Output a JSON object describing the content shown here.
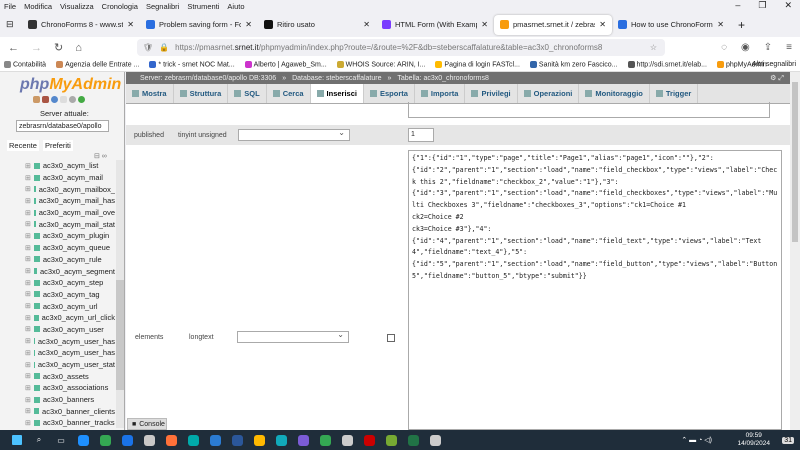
{
  "menubar": [
    "File",
    "Modifica",
    "Visualizza",
    "Cronologia",
    "Segnalibri",
    "Strumenti",
    "Aiuto"
  ],
  "browser_tabs": [
    {
      "title": "ChronoForms 8 - www.stebersca",
      "color": "#333"
    },
    {
      "title": "Problem saving form - Forums",
      "color": "#2a6ee0"
    },
    {
      "title": "Ritiro usato",
      "color": "#111"
    },
    {
      "title": "HTML Form (With Examples)",
      "color": "#7a3cff"
    },
    {
      "title": "pmasrnet.srnet.it / zebrasrn/da",
      "color": "#f89c0e",
      "active": true
    },
    {
      "title": "How to use ChronoForms 8 - In",
      "color": "#2a6ee0"
    }
  ],
  "url": {
    "prefix": "https://pmasrnet.",
    "domain": "srnet.it",
    "rest": "/phpmyadmin/index.php?route=/&route=%2F&db=steberscaffalature&table=ac3x0_chronoforms8"
  },
  "bookmarks": [
    "Contabilità",
    "Agenzia delle Entrate ...",
    "* trick - srnet NOC Mat...",
    "Alberto | Agaweb_Sm...",
    "WHOIS Source: ARIN, I...",
    "Pagina di login FASTcl...",
    "Sanità km zero Fascico...",
    "http://sdi.srnet.it/elab...",
    "phpMyAdmin"
  ],
  "bookmarks_other": "Altri segnalibri",
  "sidebar": {
    "logo_php": "php",
    "logo_myadmin": "MyAdmin",
    "server_label": "Server attuale:",
    "server_value": "zebrasrn/database0/apollo",
    "recent": "Recente",
    "favorites": "Preferiti",
    "tables": [
      "ac3x0_acym_list",
      "ac3x0_acym_mail",
      "ac3x0_acym_mailbox_",
      "ac3x0_acym_mail_has",
      "ac3x0_acym_mail_ove",
      "ac3x0_acym_mail_stat",
      "ac3x0_acym_plugin",
      "ac3x0_acym_queue",
      "ac3x0_acym_rule",
      "ac3x0_acym_segment",
      "ac3x0_acym_step",
      "ac3x0_acym_tag",
      "ac3x0_acym_url",
      "ac3x0_acym_url_click",
      "ac3x0_acym_user",
      "ac3x0_acym_user_has",
      "ac3x0_acym_user_has",
      "ac3x0_acym_user_stat",
      "ac3x0_assets",
      "ac3x0_associations",
      "ac3x0_banners",
      "ac3x0_banner_clients",
      "ac3x0_banner_tracks"
    ]
  },
  "breadcrumb": [
    "Server: zebrasrn/database0/apollo DB:3306",
    "Database: steberscaffalature",
    "Tabella: ac3x0_chronoforms8"
  ],
  "tabs": [
    {
      "label": "Mostra"
    },
    {
      "label": "Struttura"
    },
    {
      "label": "SQL"
    },
    {
      "label": "Cerca"
    },
    {
      "label": "Inserisci",
      "active": true
    },
    {
      "label": "Esporta"
    },
    {
      "label": "Importa"
    },
    {
      "label": "Privilegi"
    },
    {
      "label": "Operazioni"
    },
    {
      "label": "Monitoraggio"
    },
    {
      "label": "Trigger"
    }
  ],
  "rows": [
    {
      "name": "published",
      "type": "tinyint unsigned",
      "function": "",
      "value": "1"
    },
    {
      "name": "elements",
      "type": "longtext",
      "function": "",
      "value": "{\"1\":{\"id\":\"1\",\"type\":\"page\",\"title\":\"Page1\",\"alias\":\"page1\",\"icon\":\"\"},\"2\":\n{\"id\":\"2\",\"parent\":\"1\",\"section\":\"load\",\"name\":\"field_checkbox\",\"type\":\"views\",\"label\":\"Check this 2\",\"fieldname\":\"checkbox_2\",\"value\":\"1\"},\"3\":\n{\"id\":\"3\",\"parent\":\"1\",\"section\":\"load\",\"name\":\"field_checkboxes\",\"type\":\"views\",\"label\":\"Multi Checkboxes 3\",\"fieldname\":\"checkboxes_3\",\"options\":\"ck1=Choice #1\nck2=Choice #2\nck3=Choice #3\"},\"4\":\n{\"id\":\"4\",\"parent\":\"1\",\"section\":\"load\",\"name\":\"field_text\",\"type\":\"views\",\"label\":\"Text 4\",\"fieldname\":\"text_4\"},\"5\":\n{\"id\":\"5\",\"parent\":\"1\",\"section\":\"load\",\"name\":\"field_button\",\"type\":\"views\",\"label\":\"Button 5\",\"fieldname\":\"button_5\",\"btype\":\"submit\"}}"
    }
  ],
  "console": "Console",
  "taskbar": {
    "time": "09:59",
    "date": "14/09/2024",
    "notifications": "31"
  }
}
